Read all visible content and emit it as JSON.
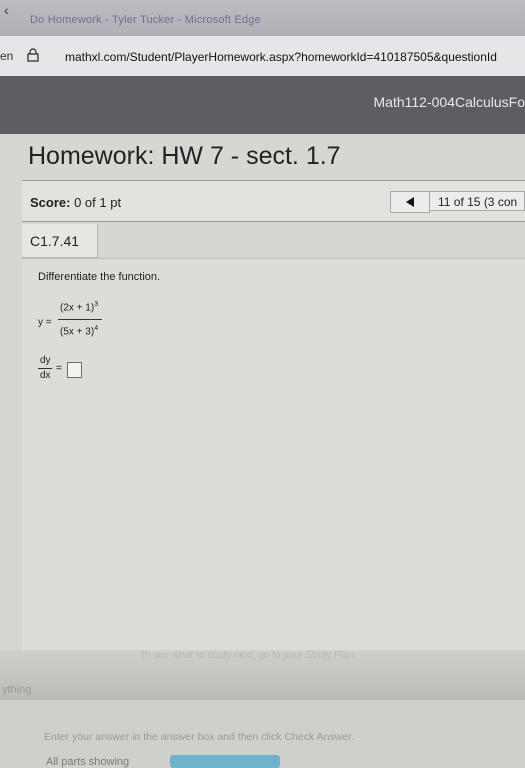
{
  "browser": {
    "window_title": "Do Homework - Tyler Tucker - Microsoft Edge",
    "tab_stub": "en",
    "url": "mathxl.com/Student/PlayerHomework.aspx?homeworkId=410187505&questionId"
  },
  "course": {
    "name": "Math112-004CalculusFo"
  },
  "homework": {
    "title": "Homework: HW 7 - sect. 1.7",
    "score_label": "Score:",
    "score_value": "0 of 1 pt",
    "question_nav": "11 of 15 (3 con",
    "question_id": "C1.7.41"
  },
  "question": {
    "instruction": "Differentiate the function.",
    "y_eq": "y =",
    "numerator": "(2x + 1)",
    "numerator_exp": "3",
    "denominator": "(5x + 3)",
    "denominator_exp": "4",
    "dy": "dy",
    "dx": "dx",
    "eq": "="
  },
  "footer": {
    "hint": "Enter your answer in the answer box and then click Check Answer.",
    "parts_label": "All parts showing",
    "progress_fraction": 1.0,
    "tip": "To see what to study next, go to your Study Plan",
    "corner_text": "ything"
  },
  "colors": {
    "course_band": "#5c5e63",
    "progress_fill": "#6fb3c8"
  }
}
